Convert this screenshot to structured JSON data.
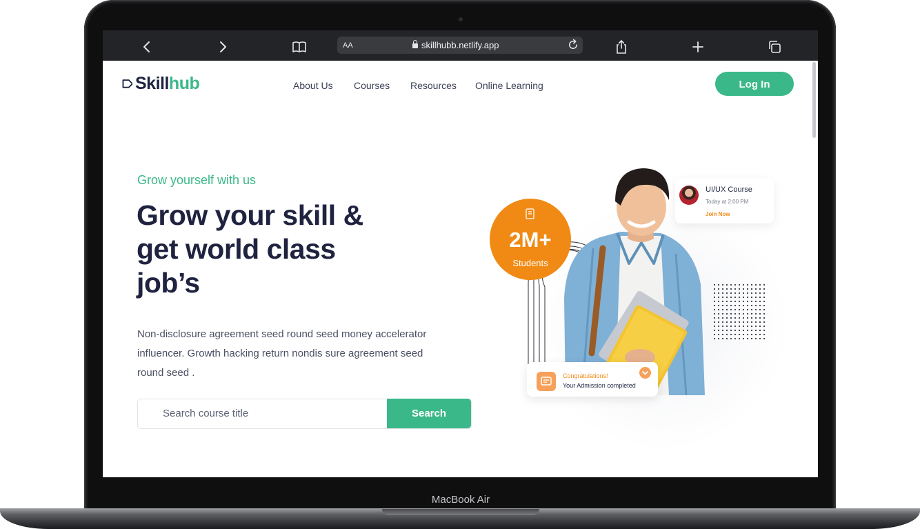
{
  "device": {
    "model_label": "MacBook Air"
  },
  "browser": {
    "url": "skillhubb.netlify.app",
    "text_size_label": "AA",
    "icons": [
      "back-icon",
      "forward-icon",
      "book-icon",
      "reload-icon",
      "share-icon",
      "new-tab-icon",
      "tabs-icon"
    ]
  },
  "logo": {
    "primary": "Skill",
    "accent": "hub"
  },
  "nav": {
    "items": [
      "About Us",
      "Courses",
      "Resources",
      "Online Learning"
    ],
    "login_label": "Log In"
  },
  "hero": {
    "eyebrow": "Grow yourself with us",
    "headline": [
      "Grow your skill &",
      "get world class",
      "job’s"
    ],
    "description": [
      "Non-disclosure agreement seed round seed money accelerator",
      "influencer. Growth hacking return nondis sure agreement seed",
      "round seed ."
    ],
    "search": {
      "placeholder": "Search course title",
      "button_label": "Search"
    }
  },
  "stats_badge": {
    "value": "2M+",
    "label": "Students"
  },
  "course_card": {
    "title": "UI/UX Course",
    "time": "Today at 2:00 PM",
    "action": "Join Now"
  },
  "notification": {
    "title": "Congratulations!",
    "body": "Your Admission completed"
  },
  "colors": {
    "accent": "#3bb88a",
    "brand_dark": "#1f2340",
    "orange": "#f08a14",
    "chrome": "#232428"
  }
}
